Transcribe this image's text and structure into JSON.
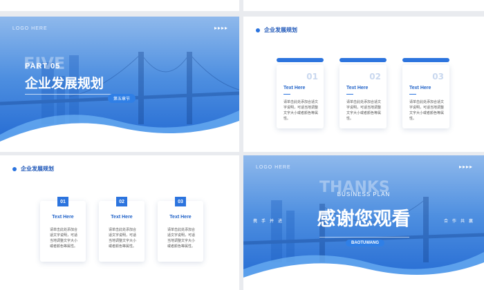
{
  "common": {
    "logo_here": "LOGO HERE",
    "arrows": "▸▸▸▸"
  },
  "slide1": {
    "ghost_text": "FIVE",
    "part": "PART  05",
    "title": "企业发展规划",
    "chapter": "第五章节"
  },
  "slide2": {
    "section_title": "企业发展规划",
    "cards": [
      {
        "num": "01",
        "title": "Text Here",
        "body": "请单击此处添加合适文字说明，可适当地调整文字大小或者颜色等属性。"
      },
      {
        "num": "02",
        "title": "Text Here",
        "body": "请单击此处添加合适文字说明，可适当地调整文字大小或者颜色等属性。"
      },
      {
        "num": "03",
        "title": "Text Here",
        "body": "请单击此处添加合适文字说明，可适当地调整文字大小或者颜色等属性。"
      }
    ]
  },
  "slide3": {
    "section_title": "企业发展规划",
    "cards": [
      {
        "num": "01",
        "title": "Text Here",
        "body": "请单击此处添加合适文字说明，可适当地调整文字大小或者颜色等属性。"
      },
      {
        "num": "02",
        "title": "Text Here",
        "body": "请单击此处添加合适文字说明，可适当地调整文字大小或者颜色等属性。"
      },
      {
        "num": "03",
        "title": "Text Here",
        "body": "请单击此处添加合适文字说明，可适当地调整文字大小或者颜色等属性。"
      }
    ]
  },
  "slide4": {
    "ghost_text": "THANKS",
    "subtitle": "BUSINESS PLAN",
    "title": "感谢您观看",
    "left_chars": "携手并进",
    "right_chars": "合作共赢",
    "pill": "BAOTUWANG"
  },
  "colors": {
    "accent": "#2c74de",
    "heading": "#1d56b8"
  }
}
